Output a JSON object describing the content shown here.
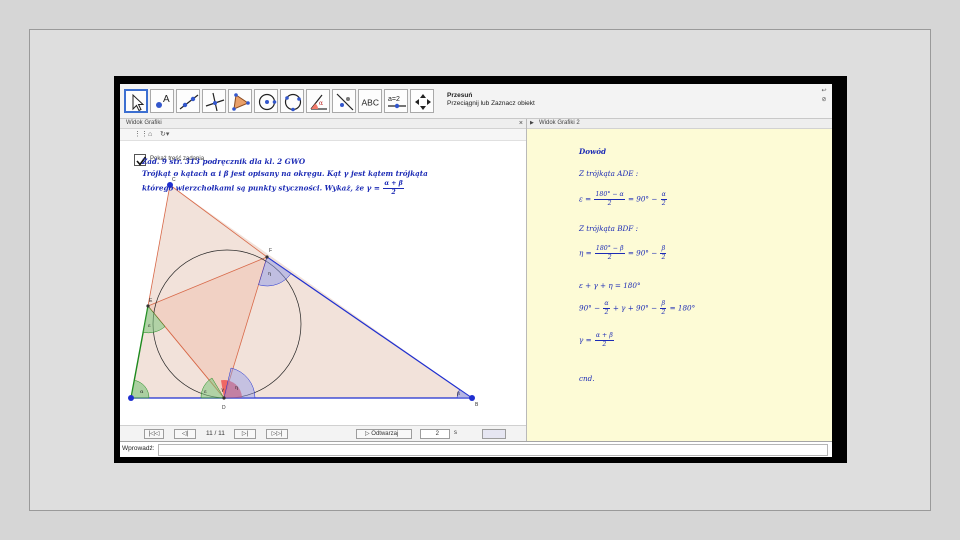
{
  "toolbar": {
    "tool_hint_title": "Przesuń",
    "tool_hint_desc": "Przeciągnij lub Zaznacz obiekt",
    "tools": [
      {
        "name": "move-tool",
        "icon": "arrow-cursor-icon"
      },
      {
        "name": "point-tool",
        "icon": "point-a-icon"
      },
      {
        "name": "line-tool",
        "icon": "line-through-points-icon"
      },
      {
        "name": "perpendicular-tool",
        "icon": "perpendicular-line-icon"
      },
      {
        "name": "polygon-tool",
        "icon": "triangle-icon"
      },
      {
        "name": "circle-tool",
        "icon": "circle-center-icon"
      },
      {
        "name": "circle-three-points-tool",
        "icon": "circle-three-points-icon"
      },
      {
        "name": "angle-tool",
        "icon": "angle-icon"
      },
      {
        "name": "reflect-tool",
        "icon": "reflect-line-icon"
      },
      {
        "name": "text-tool",
        "icon": "text-abc-icon"
      },
      {
        "name": "slider-tool",
        "icon": "slider-a2-icon"
      },
      {
        "name": "move-view-tool",
        "icon": "move-graphics-view-icon"
      }
    ],
    "text_tool_label": "ABC",
    "slider_tool_label": "a=2"
  },
  "left_view": {
    "title": "Widok Grafiki",
    "close": "×",
    "style_bar_icons": [
      "grid-icon",
      "home-icon",
      "refresh-icon"
    ],
    "checkbox_label": "Pokaż treść zadania",
    "checkbox_checked": true,
    "problem_line1": "Zad. 9 str. 313 podręcznik dla kl. 2 GWO",
    "problem_line2": "Trójkąt o kątach α i β jest opisany na okręgu. Kąt γ jest kątem trójkąta",
    "problem_line3": "którego wierzchołkami są punkty styczności. Wykaż, że γ =",
    "problem_frac_num": "α + β",
    "problem_frac_den": "2",
    "points": {
      "A": "A",
      "B": "B",
      "C": "C",
      "D": "D",
      "E": "E",
      "F": "F"
    },
    "angle_labels": {
      "alpha": "α",
      "beta": "β",
      "gamma": "γ",
      "eps": "ε",
      "eta": "η",
      "eps2": "ε",
      "eta2": "η"
    }
  },
  "navigation": {
    "first": "|◁◁",
    "prev": "◁|",
    "count": "11 / 11",
    "next": "▷|",
    "last": "▷▷|",
    "play_label": "Odtwarzaj",
    "speed_value": "2",
    "speed_unit": "s"
  },
  "right_view": {
    "title": "Widok Grafiki 2",
    "dowod": "Dowód",
    "z_trojkata_ade": "Z trójkąta ADE :",
    "eq1_lhs": "ε =",
    "eq1_num": "180° − α",
    "eq1_den": "2",
    "eq1_mid": "= 90° −",
    "eq1_num2": "α",
    "eq1_den2": "2",
    "z_trojkata_bdf": "Z trójkąta BDF :",
    "eq2_lhs": "η =",
    "eq2_num": "180° − β",
    "eq2_den": "2",
    "eq2_mid": "= 90° −",
    "eq2_num2": "β",
    "eq2_den2": "2",
    "eq3": "ε + γ + η = 180°",
    "eq4_a": "90° −",
    "eq4_num1": "α",
    "eq4_den1": "2",
    "eq4_b": "+ γ + 90° −",
    "eq4_num2": "β",
    "eq4_den2": "2",
    "eq4_c": "= 180°",
    "eq5_lhs": "γ =",
    "eq5_num": "α + β",
    "eq5_den": "2",
    "cnd": "cnd."
  },
  "input_bar": {
    "label": "Wprowadź:",
    "value": ""
  },
  "colors": {
    "triangle_fill": "#f2dcd2",
    "triangle_edge": "#e07a5a",
    "side_blue": "#1f2fd0",
    "side_green": "#1e8a1e",
    "angle_red": "#ee4444",
    "angle_blue": "#8e99e8",
    "angle_green": "#7cc47c",
    "math_text": "#1c2bb5",
    "pane_yellow": "#fdfbd6"
  }
}
